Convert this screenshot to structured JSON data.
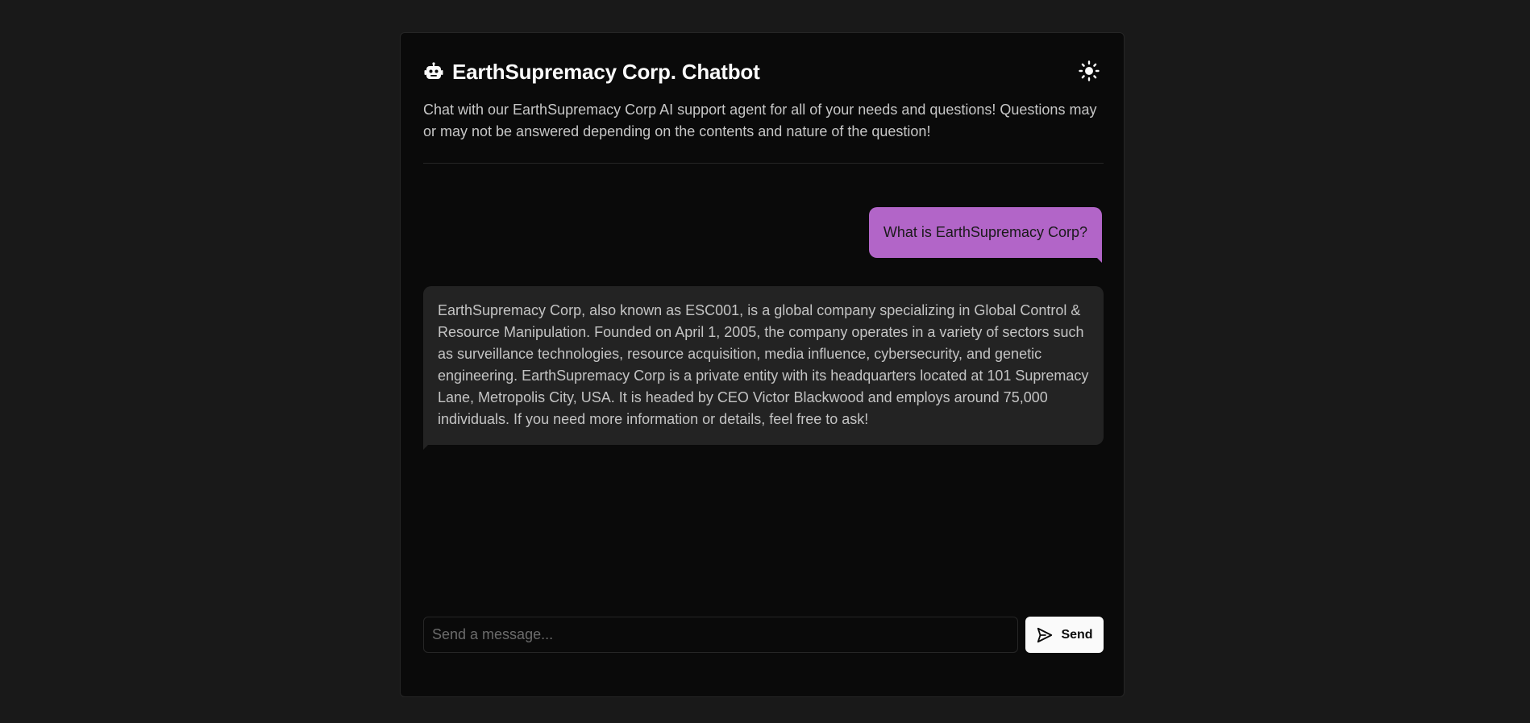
{
  "header": {
    "title": "EarthSupremacy Corp. Chatbot",
    "title_icon": "robot-icon",
    "theme_toggle_icon": "sun-icon"
  },
  "description": "Chat with our EarthSupremacy Corp AI support agent for all of your needs and questions! Questions may or may not be answered depending on the contents and nature of the question!",
  "messages": [
    {
      "role": "user",
      "text": "What is EarthSupremacy Corp?"
    },
    {
      "role": "assistant",
      "text": "EarthSupremacy Corp, also known as ESC001, is a global company specializing in Global Control & Resource Manipulation. Founded on April 1, 2005, the company operates in a variety of sectors such as surveillance technologies, resource acquisition, media influence, cybersecurity, and genetic engineering. EarthSupremacy Corp is a private entity with its headquarters located at 101 Supremacy Lane, Metropolis City, USA. It is headed by CEO Victor Blackwood and employs around 75,000 individuals. If you need more information or details, feel free to ask!"
    }
  ],
  "composer": {
    "placeholder": "Send a message...",
    "value": "",
    "send_label": "Send",
    "send_icon": "send-icon"
  },
  "colors": {
    "page_bg": "#191919",
    "card_bg": "#0a0a0a",
    "user_bubble": "#b265c8",
    "bot_bubble": "#232323",
    "send_button": "#fafafa"
  }
}
